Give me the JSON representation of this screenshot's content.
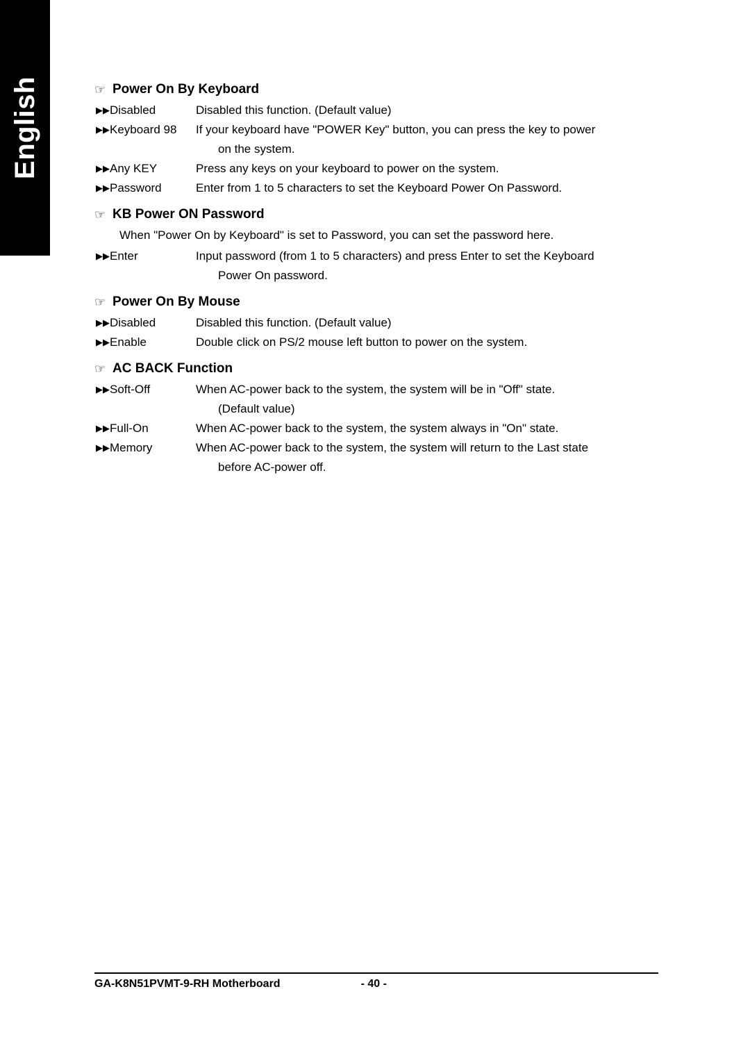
{
  "side_tab": {
    "label": "English"
  },
  "sections": [
    {
      "heading_bullet": "☞",
      "heading": "Power On By Keyboard",
      "options": [
        {
          "bullet": "▶▶",
          "term": "Disabled",
          "desc": "Disabled this function. (Default value)",
          "cont": ""
        },
        {
          "bullet": "▶▶",
          "term": "Keyboard 98",
          "desc": "If your keyboard have \"POWER Key\" button, you can press the key to power",
          "cont": "on the system."
        },
        {
          "bullet": "▶▶",
          "term": "Any KEY",
          "desc": "Press any keys on your keyboard to power on the system.",
          "cont": ""
        },
        {
          "bullet": "▶▶",
          "term": "Password",
          "desc": "Enter from 1 to 5 characters to set the Keyboard Power On Password.",
          "cont": ""
        }
      ],
      "paragraph": ""
    },
    {
      "heading_bullet": "☞",
      "heading": "KB Power ON Password",
      "paragraph": "When \"Power On by Keyboard\" is set to Password, you can set the password here.",
      "options": [
        {
          "bullet": "▶▶",
          "term": "Enter",
          "desc": "Input password (from 1 to 5 characters) and press Enter to set the Keyboard",
          "cont": "Power On password."
        }
      ]
    },
    {
      "heading_bullet": "☞",
      "heading": "Power On By Mouse",
      "paragraph": "",
      "options": [
        {
          "bullet": "▶▶",
          "term": "Disabled",
          "desc": "Disabled this function. (Default value)",
          "cont": ""
        },
        {
          "bullet": "▶▶",
          "term": "Enable",
          "desc": "Double click on PS/2 mouse left button to power on the system.",
          "cont": ""
        }
      ]
    },
    {
      "heading_bullet": "☞",
      "heading": "AC BACK Function",
      "paragraph": "",
      "options": [
        {
          "bullet": "▶▶",
          "term": "Soft-Off",
          "desc": "When AC-power back to the system, the system will be in \"Off\" state.",
          "cont": "(Default value)"
        },
        {
          "bullet": "▶▶",
          "term": "Full-On",
          "desc": "When AC-power back to the system, the system always in \"On\" state.",
          "cont": ""
        },
        {
          "bullet": "▶▶",
          "term": "Memory",
          "desc": "When AC-power back to the system, the system will return to the Last state",
          "cont": "before AC-power off."
        }
      ]
    }
  ],
  "footer": {
    "left": "GA-K8N51PVMT-9-RH Motherboard",
    "center": "- 40 -"
  }
}
